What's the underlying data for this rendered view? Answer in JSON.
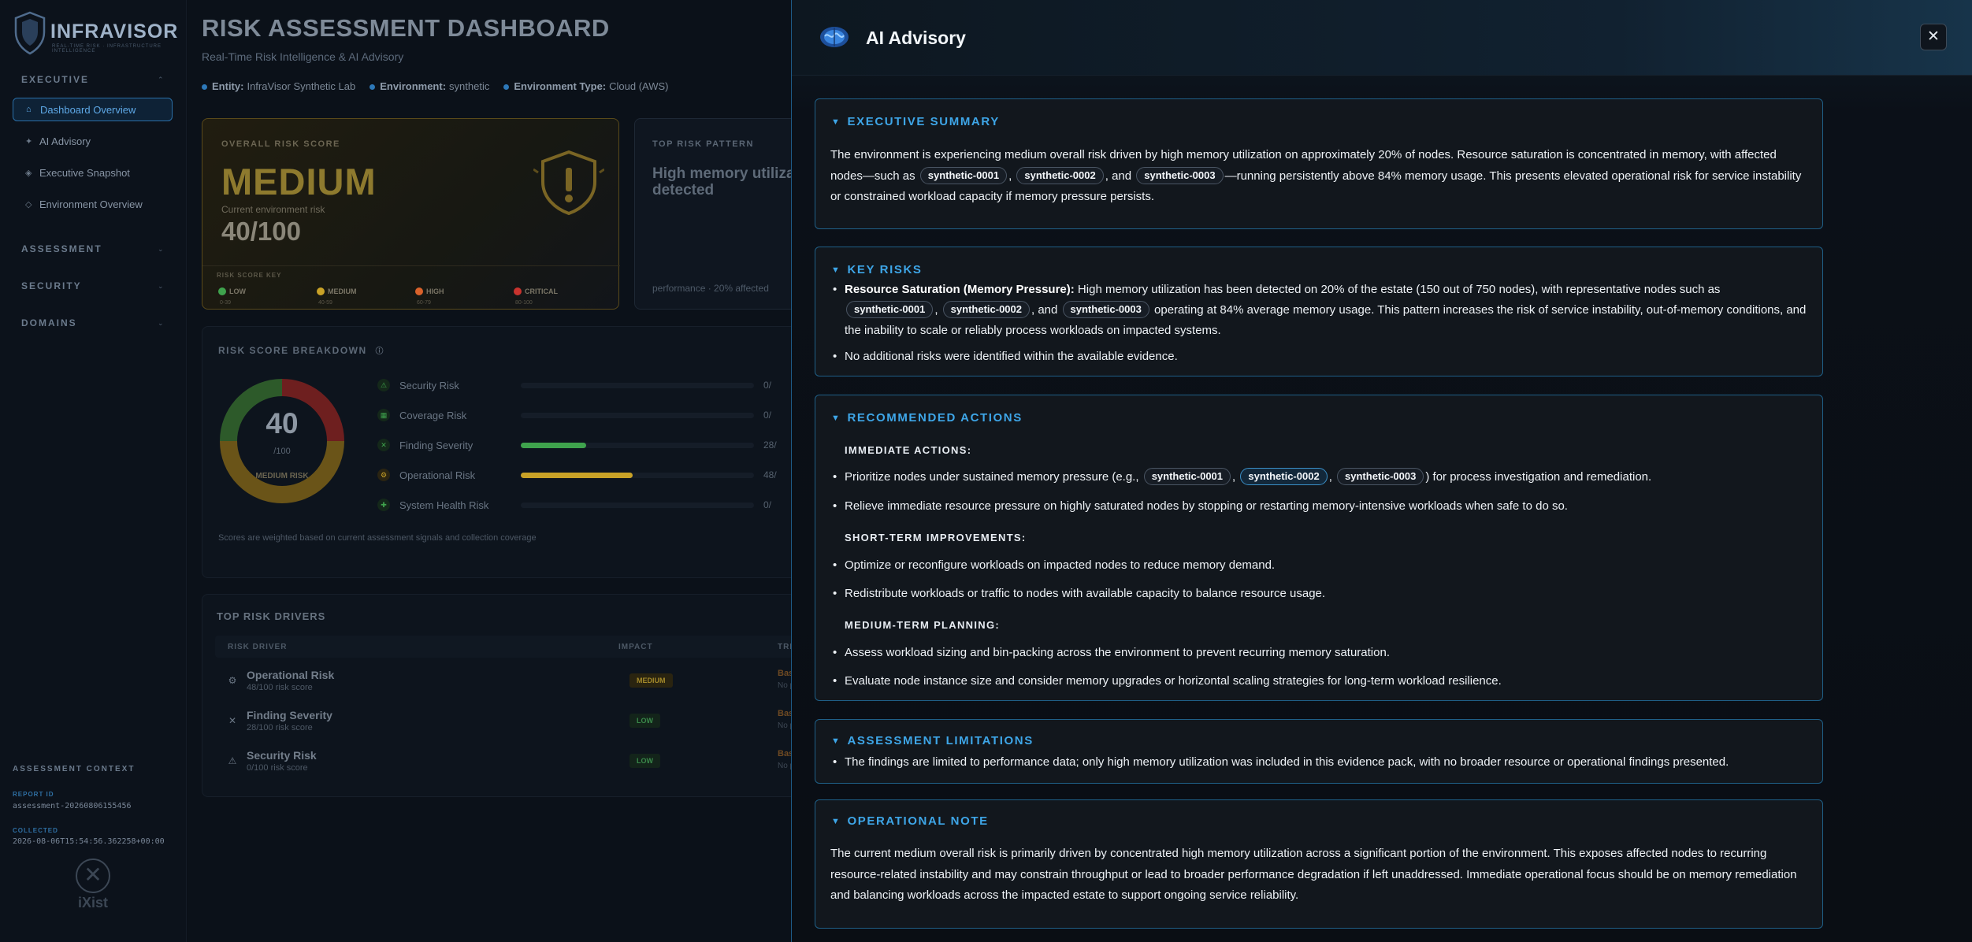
{
  "sidebar": {
    "logo_text": "INFRAVISOR",
    "logo_tagline": "REAL-TIME RISK · INFRASTRUCTURE INTELLIGENCE",
    "sections": {
      "executive": "EXECUTIVE",
      "assessment": "ASSESSMENT",
      "security": "SECURITY",
      "domains": "DOMAINS"
    },
    "items": [
      {
        "label": "Dashboard Overview",
        "icon": "home-icon"
      },
      {
        "label": "AI Advisory",
        "icon": "sparkle-icon"
      },
      {
        "label": "Executive Snapshot",
        "icon": "diamond-icon"
      },
      {
        "label": "Environment Overview",
        "icon": "diamond-outline-icon"
      }
    ],
    "context": {
      "title": "ASSESSMENT CONTEXT",
      "report_id_label": "REPORT ID",
      "report_id": "assessment-20260806155456",
      "collected_label": "COLLECTED",
      "collected": "2026-08-06T15:54:56.362258+00:00"
    },
    "footer_logo": "iXist"
  },
  "main": {
    "title": "RISK ASSESSMENT DASHBOARD",
    "subtitle": "Real-Time Risk Intelligence & AI Advisory",
    "meta": {
      "entity_label": "Entity:",
      "entity": "InfraVisor Synthetic Lab",
      "environment_label": "Environment:",
      "environment": "synthetic",
      "env_type_label": "Environment Type:",
      "env_type": "Cloud (AWS)"
    },
    "overall": {
      "label": "OVERALL RISK SCORE",
      "level": "MEDIUM",
      "caption": "Current environment risk",
      "score": "40/100",
      "key_title": "RISK SCORE KEY",
      "keys": [
        {
          "name": "LOW",
          "range": "0-39",
          "color": "#3fa34d"
        },
        {
          "name": "MEDIUM",
          "range": "40-59",
          "color": "#c9a227"
        },
        {
          "name": "HIGH",
          "range": "60-79",
          "color": "#d9622b"
        },
        {
          "name": "CRITICAL",
          "range": "80-100",
          "color": "#c8332e"
        }
      ]
    },
    "pattern": {
      "label": "TOP RISK PATTERN",
      "text": "High memory utilization detected",
      "footer": "performance · 20% affected"
    },
    "breakdown": {
      "title": "RISK SCORE BREAKDOWN",
      "score": "40",
      "denominator": "/100",
      "level": "MEDIUM RISK",
      "gauge_value": 0.4,
      "rows": [
        {
          "name": "Security Risk",
          "value": "0/",
          "fill": 0,
          "color": "#3fa34d"
        },
        {
          "name": "Coverage Risk",
          "value": "0/",
          "fill": 0,
          "color": "#3fa34d"
        },
        {
          "name": "Finding Severity",
          "value": "28/",
          "fill": 0.28,
          "color": "#3fa34d"
        },
        {
          "name": "Operational Risk",
          "value": "48/",
          "fill": 0.48,
          "color": "#c9a227"
        },
        {
          "name": "System Health Risk",
          "value": "0/",
          "fill": 0,
          "color": "#3fa34d"
        }
      ],
      "note": "Scores are weighted based on current assessment signals and collection coverage"
    },
    "drivers": {
      "title": "TOP RISK DRIVERS",
      "headers": [
        "RISK DRIVER",
        "IMPACT",
        "TREND"
      ],
      "rows": [
        {
          "name": "Operational Risk",
          "sub": "48/100 risk score",
          "impact": "MEDIUM",
          "trend": "Baseli",
          "trend_sub": "No prio"
        },
        {
          "name": "Finding Severity",
          "sub": "28/100 risk score",
          "impact": "LOW",
          "trend": "Baseli",
          "trend_sub": "No prio"
        },
        {
          "name": "Security Risk",
          "sub": "0/100 risk score",
          "impact": "LOW",
          "trend": "Baseli",
          "trend_sub": "No prio"
        }
      ]
    }
  },
  "advisory": {
    "title": "AI Advisory",
    "close": "✕",
    "exec_summary": {
      "title": "EXECUTIVE SUMMARY",
      "text_a": "The environment is experiencing medium overall risk driven by high memory utilization on approximately 20% of nodes. Resource saturation is concentrated in memory, with affected nodes—such as ",
      "text_b": ", and ",
      "text_c": "—running persistently above 84% memory usage. This presents elevated operational risk for service instability or constrained workload capacity if memory pressure persists.",
      "sep": ", "
    },
    "nodes": [
      "synthetic-0001",
      "synthetic-0002",
      "synthetic-0003"
    ],
    "key_risks": {
      "title": "KEY RISKS",
      "r1_bold": "Resource Saturation (Memory Pressure):",
      "r1_a": " High memory utilization has been detected on 20% of the estate (150 out of 750 nodes), with representative nodes such as ",
      "r1_b": ", and ",
      "r1_c": " operating at 84% average memory usage. This pattern increases the risk of service instability, out-of-memory conditions, and the inability to scale or reliably process workloads on impacted systems.",
      "sep": ", ",
      "r2": "No additional risks were identified within the available evidence."
    },
    "actions": {
      "title": "RECOMMENDED ACTIONS",
      "immediate_h": "IMMEDIATE ACTIONS:",
      "i1_a": "Prioritize nodes under sustained memory pressure (e.g., ",
      "i1_sep": ", ",
      "i1_b": ") for process investigation and remediation.",
      "i2": "Relieve immediate resource pressure on highly saturated nodes by stopping or restarting memory-intensive workloads when safe to do so.",
      "short_h": "SHORT-TERM IMPROVEMENTS:",
      "s1": "Optimize or reconfigure workloads on impacted nodes to reduce memory demand.",
      "s2": "Redistribute workloads or traffic to nodes with available capacity to balance resource usage.",
      "medium_h": "MEDIUM-TERM PLANNING:",
      "m1": "Assess workload sizing and bin-packing across the environment to prevent recurring memory saturation.",
      "m2": "Evaluate node instance size and consider memory upgrades or horizontal scaling strategies for long-term workload resilience."
    },
    "limitations": {
      "title": "ASSESSMENT LIMITATIONS",
      "l1": "The findings are limited to performance data; only high memory utilization was included in this evidence pack, with no broader resource or operational findings presented."
    },
    "op_note": {
      "title": "OPERATIONAL NOTE",
      "text": "The current medium overall risk is primarily driven by concentrated high memory utilization across a significant portion of the environment. This exposes affected nodes to recurring resource-related instability and may constrain throughput or lead to broader performance degradation if left unaddressed. Immediate operational focus should be on memory remediation and balancing workloads across the impacted estate to support ongoing service reliability."
    }
  }
}
